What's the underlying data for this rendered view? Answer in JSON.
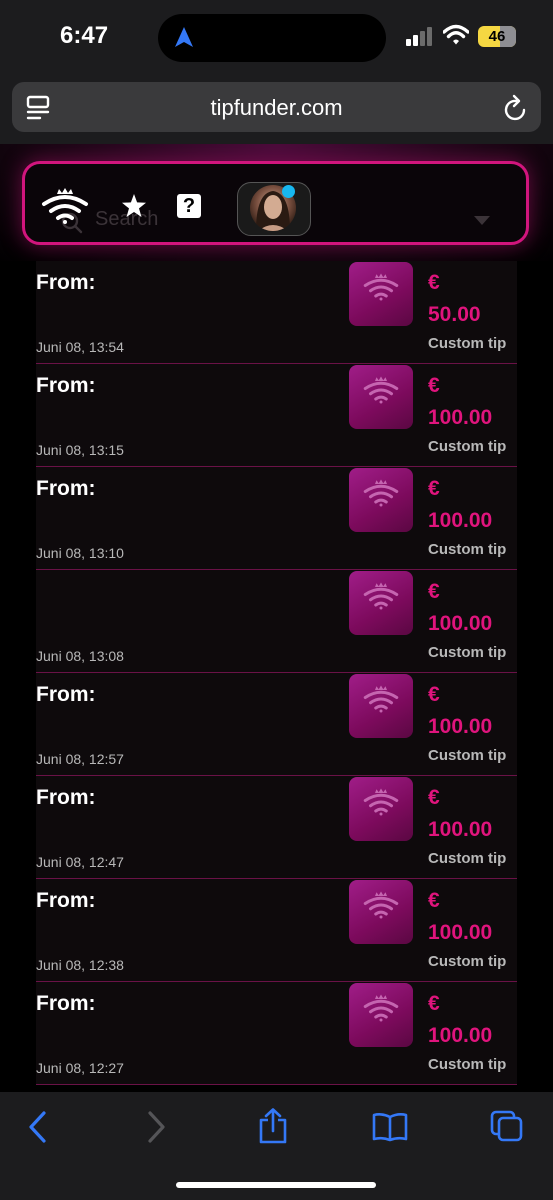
{
  "status_bar": {
    "time": "6:47",
    "battery": "46",
    "icons": [
      "location-arrow-icon",
      "signal-icon",
      "wifi-icon",
      "battery-icon"
    ]
  },
  "browser": {
    "url": "tipfunder.com",
    "icons": [
      "tab-overview-icon",
      "reload-icon"
    ]
  },
  "header": {
    "search_placeholder": "Search",
    "icons": [
      "tipfunder-logo-icon",
      "star-icon",
      "help-icon",
      "avatar",
      "dropdown-icon"
    ],
    "help_label": "?"
  },
  "tips": [
    {
      "from": "From:",
      "date": "Juni 08, 13:54",
      "currency": "€",
      "amount": "50.00",
      "kind": "Custom tip"
    },
    {
      "from": "From:",
      "date": "Juni 08, 13:15",
      "currency": "€",
      "amount": "100.00",
      "kind": "Custom tip"
    },
    {
      "from": "From:",
      "date": "Juni 08, 13:10",
      "currency": "€",
      "amount": "100.00",
      "kind": "Custom tip"
    },
    {
      "from": "",
      "date": "Juni 08, 13:08",
      "currency": "€",
      "amount": "100.00",
      "kind": "Custom tip"
    },
    {
      "from": "From:",
      "date": "Juni 08, 12:57",
      "currency": "€",
      "amount": "100.00",
      "kind": "Custom tip"
    },
    {
      "from": "From:",
      "date": "Juni 08, 12:47",
      "currency": "€",
      "amount": "100.00",
      "kind": "Custom tip"
    },
    {
      "from": "From:",
      "date": "Juni 08, 12:38",
      "currency": "€",
      "amount": "100.00",
      "kind": "Custom tip"
    },
    {
      "from": "From:",
      "date": "Juni 08, 12:27",
      "currency": "€",
      "amount": "100.00",
      "kind": "Custom tip"
    }
  ],
  "toolbar": {
    "icons": [
      "back-icon",
      "forward-icon",
      "share-icon",
      "bookmarks-icon",
      "tabs-icon"
    ]
  },
  "colors": {
    "accent": "#e0147d",
    "border": "#d1157d",
    "ios_blue": "#3478f6"
  }
}
